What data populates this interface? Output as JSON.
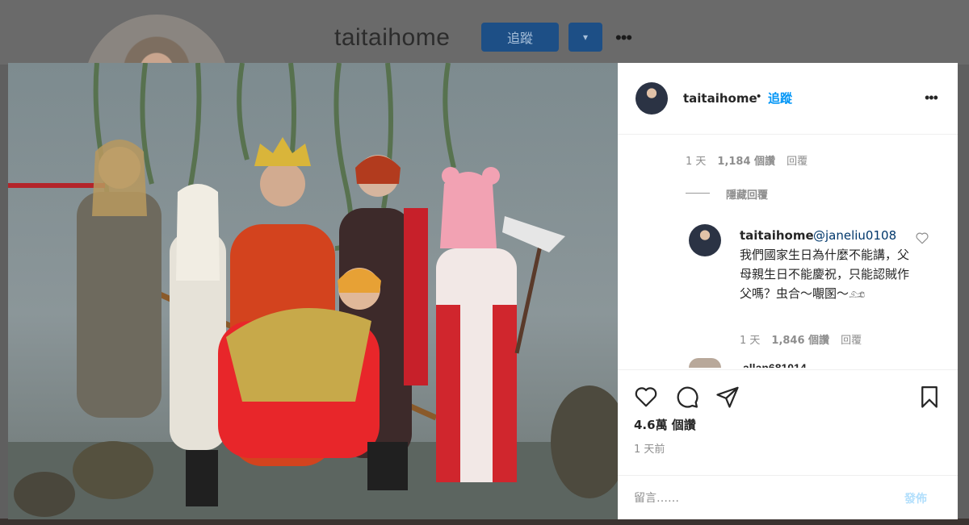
{
  "profile": {
    "username": "taitaihome",
    "follow_label": "追蹤",
    "dropdown_label": "▾",
    "more_label": "•••"
  },
  "post": {
    "author": "taitaihome",
    "separator": "•",
    "follow_label": "追蹤",
    "more_label": "•••",
    "caption_meta": {
      "age": "1 天",
      "likes": "1,184 個讚",
      "reply_label": "回覆"
    },
    "hide_replies_label": "隱藏回覆",
    "reply": {
      "username": "taitaihome",
      "mention": "@janeliu0108",
      "text": "我們國家生日為什麼不能講，父母親生日不能慶祝，只能認賊作父嗎？虫合～𡃁圂～𓃭",
      "age": "1 天",
      "likes": "1,846 個讚",
      "reply_label": "回覆"
    },
    "next_comment_peek": "allan681014",
    "like_count": "4.6萬 個讚",
    "timestamp": "1 天前",
    "comment_placeholder": "留言……",
    "post_label": "發佈"
  },
  "icons": [
    "heart-icon",
    "comment-icon",
    "share-icon",
    "bookmark-icon",
    "more-icon",
    "chevron-down-icon"
  ],
  "colors": {
    "accent": "#0095f6",
    "disabled_post": "#b2dffc",
    "muted_text": "#8e8e8e",
    "dim_overlay": "#5f5f5f"
  }
}
